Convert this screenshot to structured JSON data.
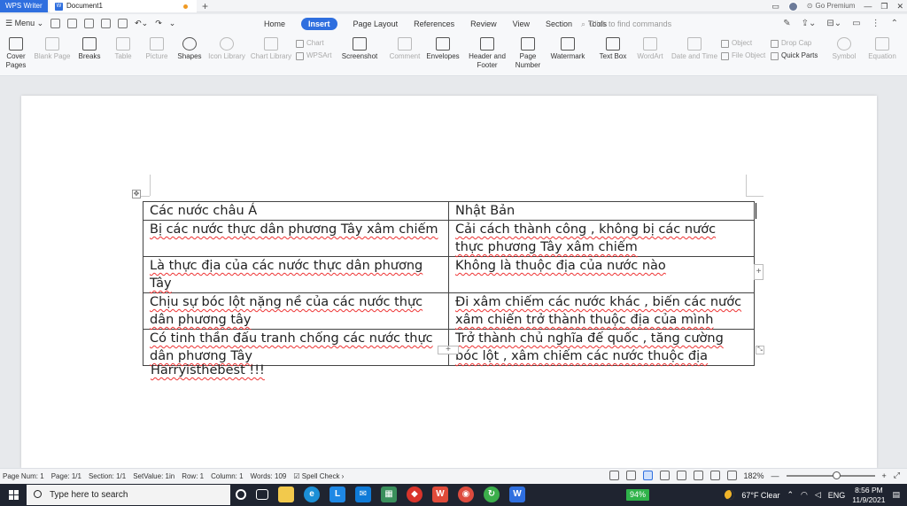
{
  "titlebar": {
    "app_name": "WPS Writer",
    "doc_tab": "Document1",
    "new_tab": "+",
    "premium": "Go Premium"
  },
  "menubar": {
    "menu_label": "Menu",
    "tabs": [
      "Home",
      "Insert",
      "Page Layout",
      "References",
      "Review",
      "View",
      "Section",
      "Tools"
    ],
    "active_tab": "Insert",
    "search_placeholder": "Click to find commands"
  },
  "ribbon": {
    "cover_pages": "Cover Pages",
    "blank_page": "Blank Page",
    "breaks": "Breaks",
    "table": "Table",
    "picture": "Picture",
    "shapes": "Shapes",
    "icon_library": "Icon Library",
    "chart_library": "Chart Library",
    "chart": "Chart",
    "wpsart": "WPSArt",
    "screenshot": "Screenshot",
    "comment": "Comment",
    "envelopes": "Envelopes",
    "header_footer": "Header and Footer",
    "page_number": "Page Number",
    "watermark": "Watermark",
    "text_box": "Text Box",
    "wordart": "WordArt",
    "date_time": "Date and Time",
    "object": "Object",
    "file_object": "File Object",
    "drop_cap": "Drop Cap",
    "quick_parts": "Quick Parts",
    "symbol": "Symbol",
    "equation": "Equation"
  },
  "document": {
    "table": [
      [
        "Các nước châu Á",
        "Nhật Bản"
      ],
      [
        "Bị các nước thực dân phương Tây xâm chiếm",
        "Cải cách thành công , không bị các nước thực phương Tây xâm chiếm"
      ],
      [
        "Là thực địa của các nước thực dân phương Tây",
        "Không là thuộc địa của nước nào"
      ],
      [
        "Chịu sự bóc lột nặng nề của các nước thực dân phương tây",
        "Đi xâm chiếm các nước khác , biến các nước xâm chiến trở thành thuộc địa của mình"
      ],
      [
        "Có tinh thần đấu tranh chống các nước thực dân phương Tây",
        "Trở thành chủ nghĩa đế quốc , tăng cường bóc lột , xâm chiếm các nước thuộc địa"
      ]
    ],
    "signature": "Harryisthebest !!!"
  },
  "statusbar": {
    "page_num": "Page Num: 1",
    "page": "Page: 1/1",
    "section": "Section: 1/1",
    "set_value": "SetValue: 1in",
    "row": "Row: 1",
    "column": "Column: 1",
    "words": "Words: 109",
    "spell_check": "Spell Check",
    "zoom": "182%"
  },
  "taskbar": {
    "search_placeholder": "Type here to search",
    "battery": "94%",
    "weather": "67°F  Clear",
    "language": "ENG",
    "time": "8:56 PM",
    "date": "11/9/2021"
  },
  "colors": {
    "accent": "#2f6fdf",
    "taskbar": "#1f2430",
    "battery": "#2fb34a"
  }
}
